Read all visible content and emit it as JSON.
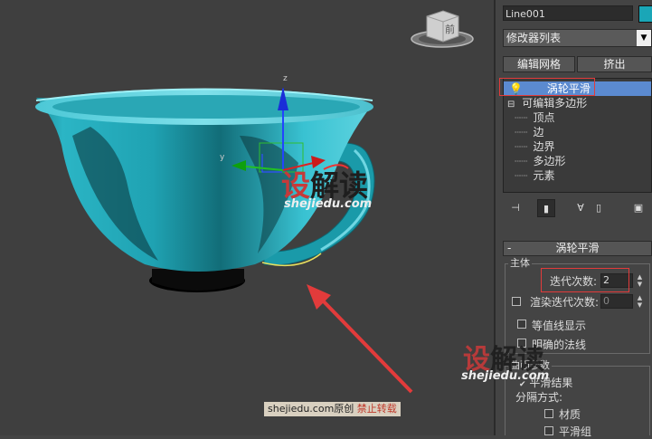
{
  "viewport": {
    "viewcube_label": "前",
    "axis_labels": {
      "x": "x",
      "y": "y",
      "z": "z"
    },
    "watermark_main": {
      "red_part": "设",
      "dark_part": "解读"
    },
    "watermark_url": "shejiedu.com",
    "caption": {
      "site": "shejiedu.com",
      "original": "原创",
      "notice": "禁止转载"
    }
  },
  "panel": {
    "object_name": "Line001",
    "object_color": "#1aa6b7",
    "modifier_list": "修改器列表",
    "buttons": {
      "edit_mesh": "编辑网格",
      "extrude": "挤出"
    },
    "stack": {
      "selected": "涡轮平滑",
      "base": "可编辑多边形",
      "sub_items": [
        "顶点",
        "边",
        "边界",
        "多边形",
        "元素"
      ]
    },
    "rollout_title": "涡轮平滑",
    "main_group": "主体",
    "iterations_label": "迭代次数:",
    "iterations_value": "2",
    "render_iters_label": "渲染迭代次数:",
    "render_iters_value": "0",
    "isoline_label": "等值线显示",
    "explicit_normals_label": "明确的法线",
    "surface_group": "曲面参数",
    "smooth_result_label": "平滑结果",
    "separate_by_label": "分隔方式:",
    "materials_label": "材质",
    "smoothing_groups_label": "平滑组",
    "panel_watermark_main": {
      "red_part": "设",
      "dark_part": "解读"
    },
    "panel_watermark_url": "shejiedu.com"
  }
}
